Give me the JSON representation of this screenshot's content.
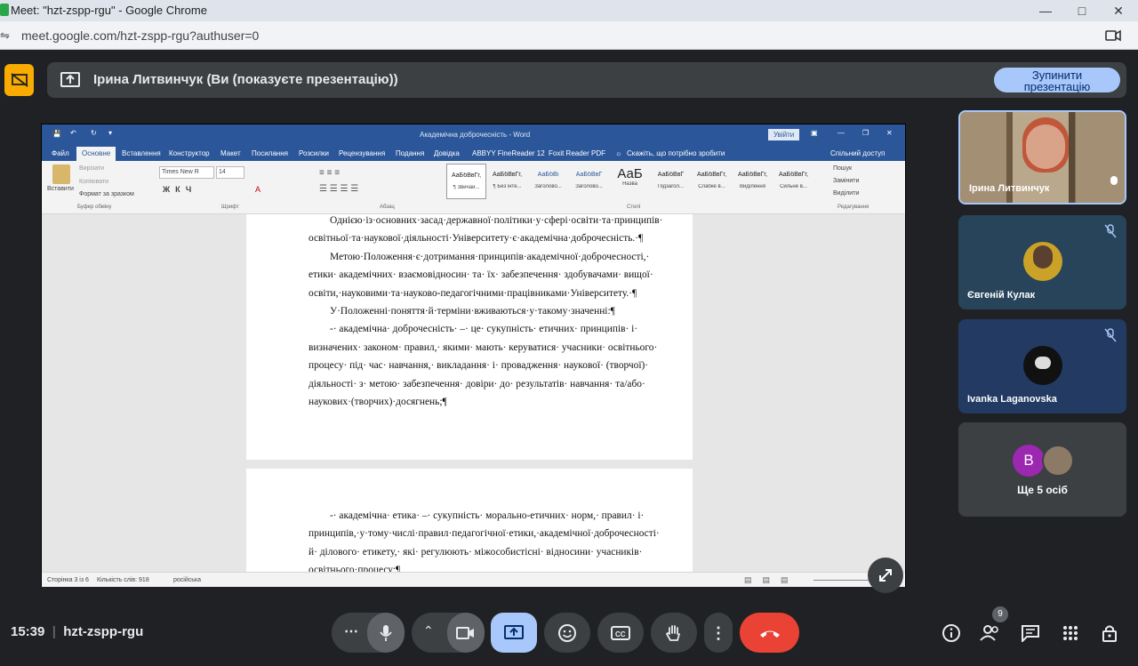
{
  "browser": {
    "title": "Meet: \"hzt-zspp-rgu\" - Google Chrome",
    "url": "meet.google.com/hzt-zspp-rgu?authuser=0"
  },
  "banner": {
    "presenter_text": "Ірина Литвинчук (Ви (показуєте презентацію))",
    "stop_label_1": "Зупинити",
    "stop_label_2": "презентацію"
  },
  "word": {
    "title": "Академічна доброчесність  -  Word",
    "login": "Увійти",
    "tabs": [
      "Файл",
      "Основне",
      "Вставлення",
      "Конструктор",
      "Макет",
      "Посилання",
      "Розсилки",
      "Рецензування",
      "Подання",
      "Довідка",
      "ABBYY FineReader 12",
      "Foxit Reader PDF"
    ],
    "tellme": "Скажіть, що потрібно зробити",
    "share": "Спільний доступ",
    "clipboard": {
      "paste": "Вставити",
      "cut": "Вирізати",
      "copy": "Копіювати",
      "format": "Формат за зразком",
      "group": "Буфер обміну"
    },
    "font": {
      "name": "Times New R",
      "size": "14",
      "group": "Шрифт"
    },
    "paragraph_group": "Абзац",
    "styles": [
      {
        "sample": "АаБбВвГг,",
        "name": "¶ Звичай..."
      },
      {
        "sample": "АаБбВвГг,",
        "name": "¶ Без інте..."
      },
      {
        "sample": "АаБбВі",
        "name": "Заголово..."
      },
      {
        "sample": "АаБбВвГ",
        "name": "Заголово..."
      },
      {
        "sample": "АаБ",
        "name": "Назва"
      },
      {
        "sample": "АаБбВвГ",
        "name": "Підзагол..."
      },
      {
        "sample": "АаБбВвГг,",
        "name": "Слабке в..."
      },
      {
        "sample": "АаБбВвГг,",
        "name": "Виділення"
      },
      {
        "sample": "АаБбВвГг,",
        "name": "Сильне в..."
      }
    ],
    "styles_group": "Стилі",
    "editing": {
      "find": "Пошук",
      "replace": "Замінити",
      "select": "Виділити",
      "group": "Редагування"
    },
    "page1_lines": [
      "Однією·із·основних·засад·державної·політики·у·сфері·освіти·та·принципів·",
      "освітньої·та·наукової·діяльності·Університету·є·академічна·доброчесність.·¶",
      "Метою·Положення·є·дотримання·принципів·академічної·доброчесності,·",
      "етики· академічних· взаємовідносин· та· їх· забезпечення· здобувачами· вищої·",
      "освіти,·науковими·та·науково-педагогічними·працівниками·Університету.·¶",
      "У·Положенні·поняття·й·терміни·вживаються·у·такому·значенні:¶",
      "-· академічна· доброчесність· –· це· сукупність· етичних· принципів· і·",
      "визначених· законом· правил,· якими· мають· керуватися· учасники· освітнього·",
      "процесу· під· час· навчання,· викладання· і· провадження· наукової· (творчої)·",
      "діяльності· з· метою· забезпечення· довіри· до· результатів· навчання· та/або·",
      "наукових·(творчих)·досягнень;¶"
    ],
    "page2_lines": [
      "-· академічна· етика· –· сукупність· морально-етичних· норм,· правил· і·",
      "принципів,·у·тому·числі·правил·педагогічної·етики,·академічної·доброчесності·",
      "й· ділового· етикету,· які· регулюють· міжособистісні· відносини· учасників·",
      "освітнього·процесу;¶"
    ],
    "status": {
      "page": "Сторінка 3 із 6",
      "words": "Кількість слів: 918",
      "lang": "російська"
    }
  },
  "participants": [
    {
      "name": "Ірина Литвинчук"
    },
    {
      "name": "Євгеній Кулак",
      "muted": true
    },
    {
      "name": "Ivanka Laganovska",
      "muted": true
    }
  ],
  "more": {
    "avatar_letter": "B",
    "label": "Ще 5 осіб"
  },
  "bottom": {
    "time": "15:39",
    "meeting_code": "hzt-zspp-rgu",
    "people_count": "9"
  },
  "colors": {
    "accent": "#a8c7fa",
    "end_call": "#ea4335",
    "word_blue": "#2b579a",
    "present_yellow": "#f9ab00"
  }
}
